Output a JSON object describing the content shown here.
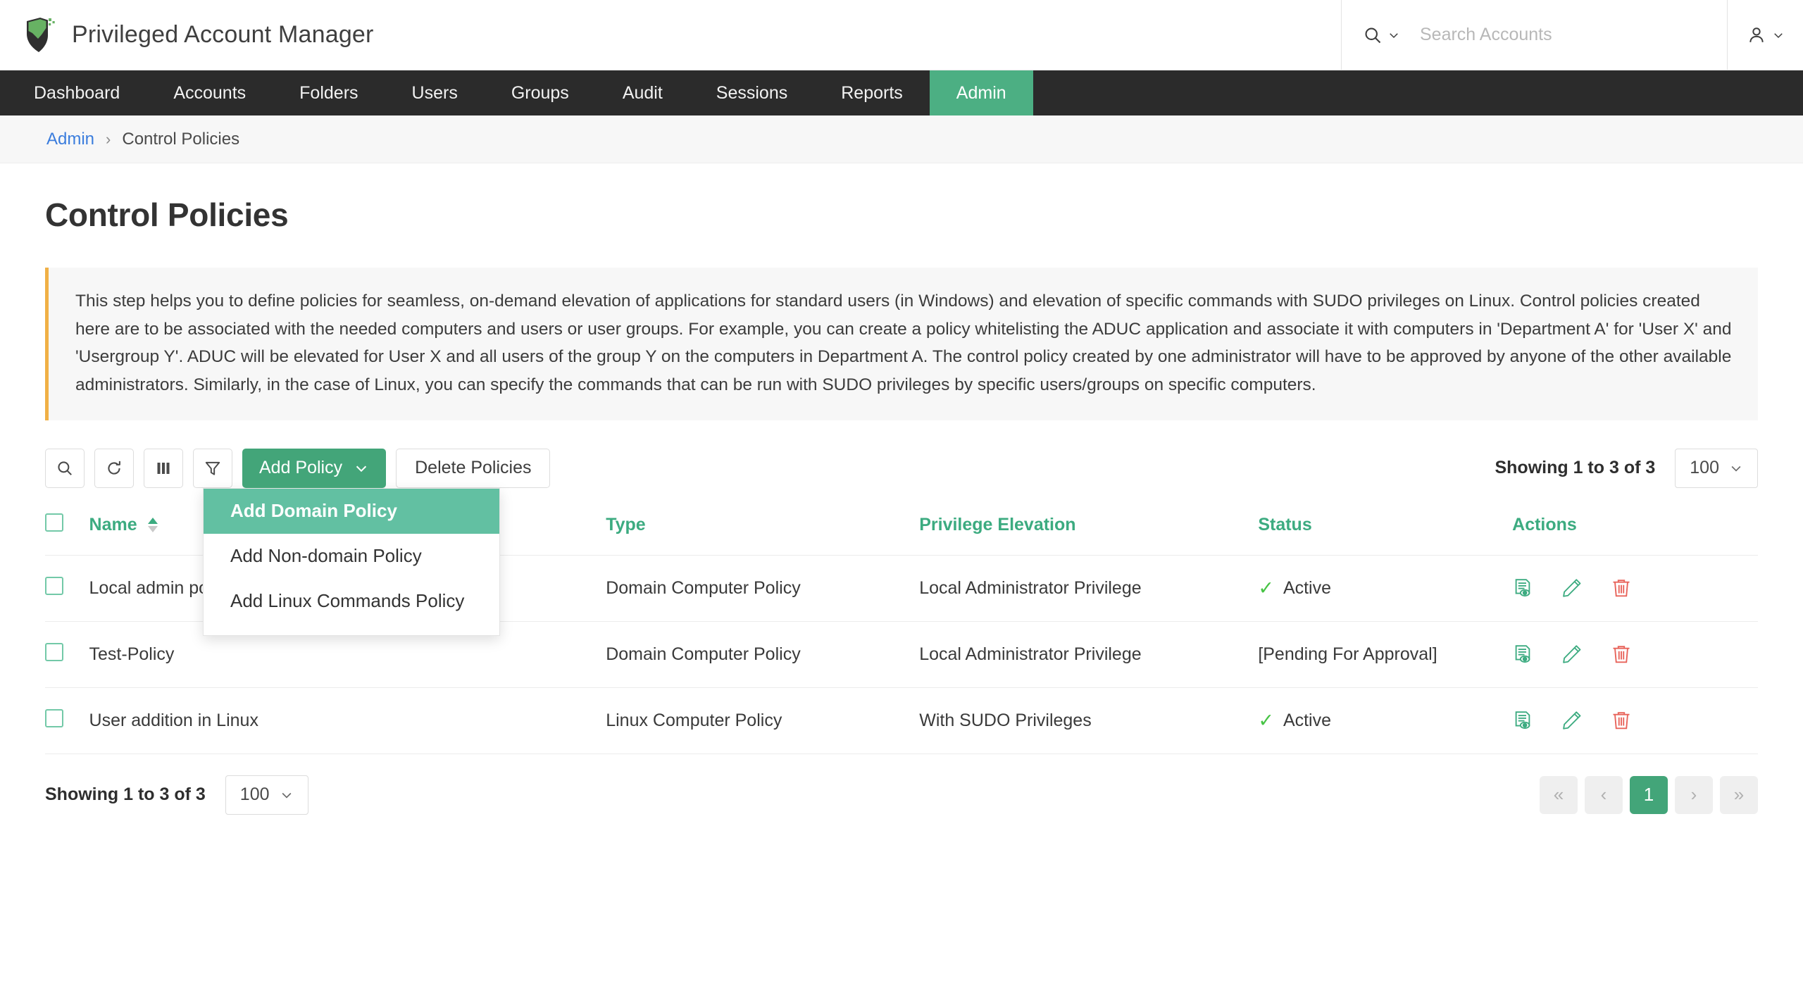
{
  "header": {
    "brand_title": "Privileged Account Manager",
    "logo_icon": "shield-logo-icon",
    "search_icon": "search-icon",
    "search_chevron_icon": "chevron-down-icon",
    "search_placeholder": "Search Accounts",
    "search_value": "",
    "user_icon": "user-account-icon",
    "user_chevron_icon": "chevron-down-icon"
  },
  "nav": {
    "items": [
      {
        "label": "Dashboard",
        "active": false
      },
      {
        "label": "Accounts",
        "active": false
      },
      {
        "label": "Folders",
        "active": false
      },
      {
        "label": "Users",
        "active": false
      },
      {
        "label": "Groups",
        "active": false
      },
      {
        "label": "Audit",
        "active": false
      },
      {
        "label": "Sessions",
        "active": false
      },
      {
        "label": "Reports",
        "active": false
      },
      {
        "label": "Admin",
        "active": true
      }
    ]
  },
  "breadcrumb": {
    "parent": "Admin",
    "separator": "›",
    "current": "Control Policies"
  },
  "page": {
    "title": "Control Policies",
    "info_text": "This step helps you to define policies for seamless, on-demand elevation of applications for standard users (in Windows) and elevation of specific commands with SUDO privileges on Linux. Control policies created here are to be associated with the needed computers and users or user groups. For example, you can create a policy whitelisting the ADUC application and associate it with computers in 'Department A' for 'User X' and 'Usergroup Y'. ADUC will be elevated for User X and all users of the group Y on the computers in Department A. The control policy created by one administrator will have to be approved by anyone of the other available administrators. Similarly, in the case of Linux, you can specify the commands that can be run with SUDO privileges by specific users/groups on specific computers."
  },
  "toolbar": {
    "search_icon": "search-icon",
    "refresh_icon": "refresh-icon",
    "columns_icon": "columns-icon",
    "filter_icon": "filter-funnel-icon",
    "add_policy_label": "Add Policy",
    "add_policy_chevron_icon": "chevron-down-icon",
    "delete_policies_label": "Delete Policies",
    "showing_text": "Showing 1 to 3 of 3",
    "page_size_value": "100",
    "page_size_chevron_icon": "chevron-down-icon"
  },
  "dropdown": {
    "items": [
      {
        "label": "Add Domain Policy",
        "highlight": true
      },
      {
        "label": "Add Non-domain Policy",
        "highlight": false
      },
      {
        "label": "Add Linux Commands Policy",
        "highlight": false
      }
    ]
  },
  "table": {
    "headers": {
      "select_all": "select-all-checkbox",
      "name": "Name",
      "sort_icon": "sort-arrows-icon",
      "type": "Type",
      "privilege": "Privilege Elevation",
      "status": "Status",
      "actions": "Actions"
    },
    "rows": [
      {
        "name": "Local admin policy",
        "type": "Domain Computer Policy",
        "privilege": "Local Administrator Privilege",
        "status": "Active",
        "status_kind": "active",
        "actions": [
          "view-policy-icon",
          "edit-policy-icon",
          "delete-policy-icon"
        ]
      },
      {
        "name": "Test-Policy",
        "type": "Domain Computer Policy",
        "privilege": "Local Administrator Privilege",
        "status": "[Pending For Approval]",
        "status_kind": "pending",
        "actions": [
          "view-policy-icon",
          "edit-policy-icon",
          "delete-policy-icon"
        ]
      },
      {
        "name": "User addition in Linux",
        "type": "Linux Computer Policy",
        "privilege": "With SUDO Privileges",
        "status": "Active",
        "status_kind": "active",
        "actions": [
          "view-policy-icon",
          "edit-policy-icon",
          "delete-policy-icon"
        ]
      }
    ]
  },
  "footer": {
    "showing_text": "Showing 1 to 3 of 3",
    "page_size_value": "100",
    "page_size_chevron_icon": "chevron-down-icon",
    "pager": {
      "first": "«",
      "prev": "‹",
      "current_page": "1",
      "next": "›",
      "last": "»"
    }
  },
  "colors": {
    "brand_green": "#43a579",
    "nav_dark": "#2b2b2b",
    "header_green": "#3cab80",
    "highlight_green": "#62c0a2",
    "link_blue": "#3b7ddd",
    "accent_orange": "#f0b046",
    "danger_red": "#e8635a",
    "active_check": "#46c344"
  }
}
